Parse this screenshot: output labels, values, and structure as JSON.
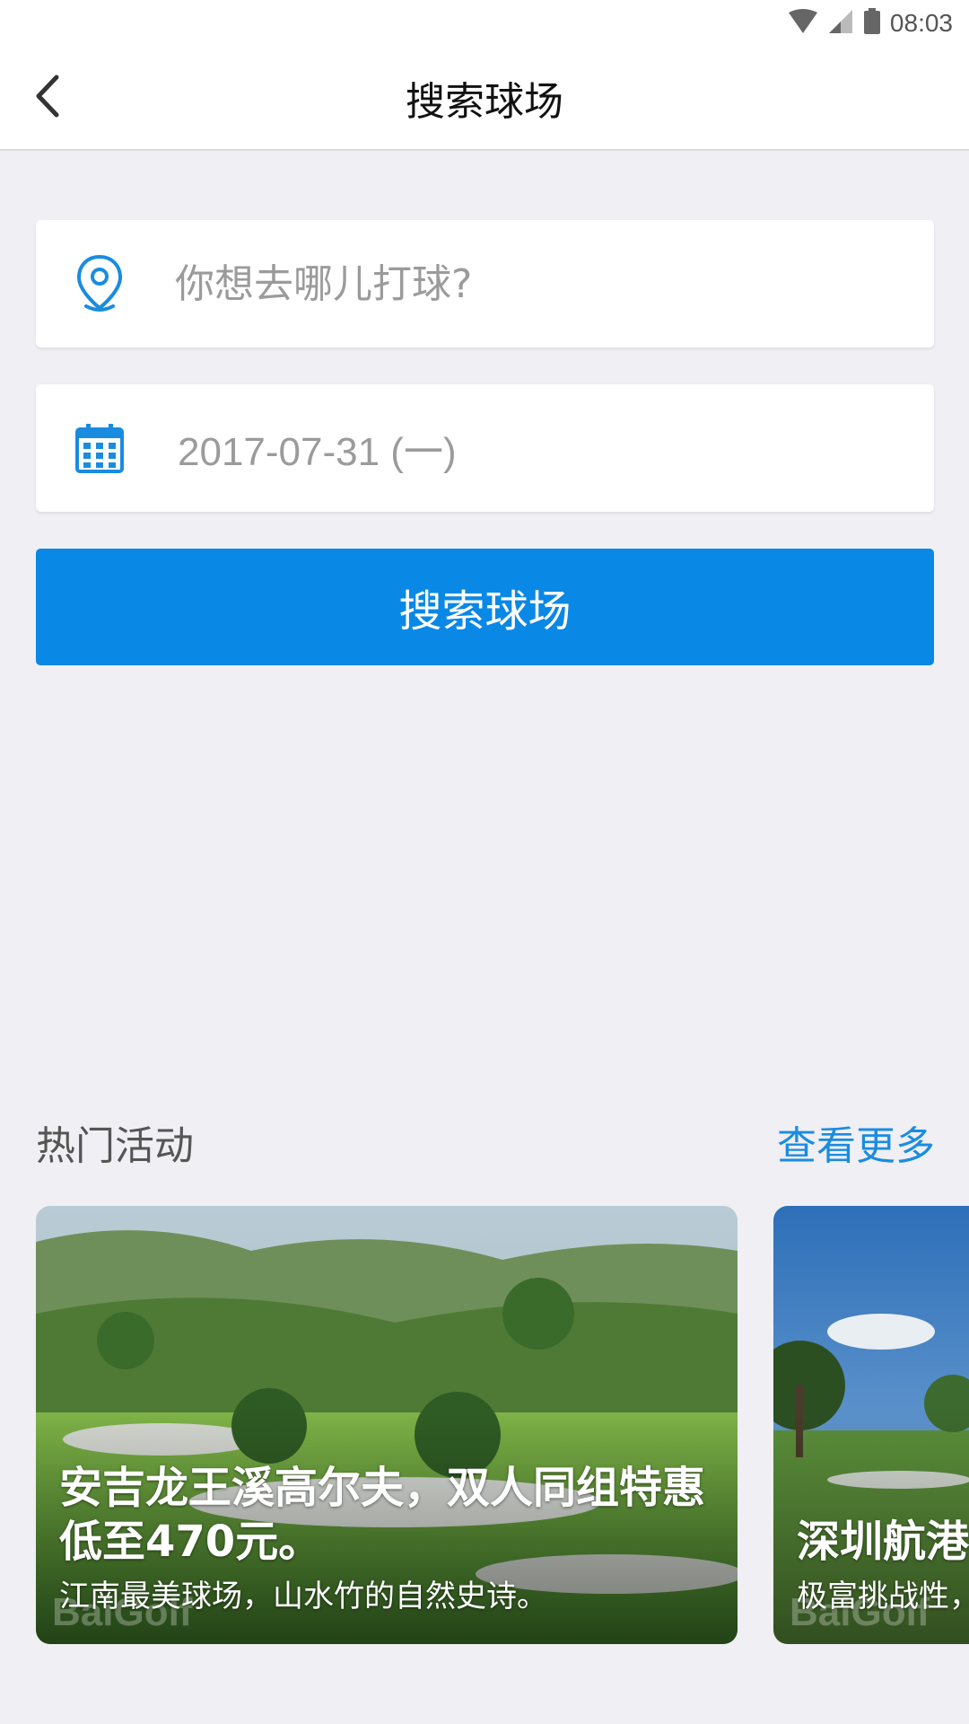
{
  "status_bar": {
    "time": "08:03",
    "icons": [
      "wifi-icon",
      "signal-icon",
      "battery-icon"
    ]
  },
  "header": {
    "title": "搜索球场",
    "back_icon": "chevron-left-icon"
  },
  "search": {
    "location_placeholder": "你想去哪儿打球?",
    "date_value": "2017-07-31 (一)",
    "button_label": "搜索球场"
  },
  "hot": {
    "title": "热门活动",
    "more_label": "查看更多",
    "cards": [
      {
        "title": "安吉龙王溪高尔夫，双人同组特惠低至470元。",
        "subtitle": "江南最美球场，山水竹的自然史诗。",
        "watermark": "BaiGolf"
      },
      {
        "title": "深圳航港",
        "subtitle": "极富挑战性，",
        "watermark": "BaiGolf"
      }
    ]
  },
  "colors": {
    "accent": "#0a88e6",
    "link": "#1a8ce0",
    "background": "#efeff4"
  }
}
